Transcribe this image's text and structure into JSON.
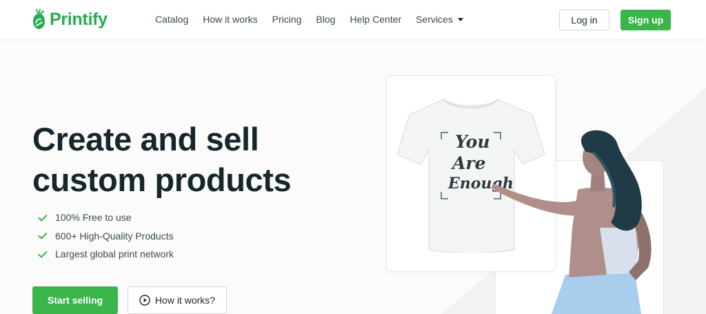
{
  "brand": {
    "name": "Printify",
    "color": "#29ab51"
  },
  "nav": {
    "items": [
      "Catalog",
      "How it works",
      "Pricing",
      "Blog",
      "Help Center"
    ],
    "services_label": "Services"
  },
  "auth": {
    "login_label": "Log in",
    "signup_label": "Sign up"
  },
  "hero": {
    "headline_line1": "Create and sell",
    "headline_line2": "custom products",
    "features": [
      "100% Free to use",
      "600+ High-Quality Products",
      "Largest global print network"
    ],
    "primary_cta": "Start selling",
    "secondary_cta": "How it works?"
  },
  "mockup": {
    "print_lines": [
      "You",
      "Are",
      "Enough"
    ]
  },
  "colors": {
    "accent": "#39b54a",
    "text_dark": "#17262b"
  }
}
